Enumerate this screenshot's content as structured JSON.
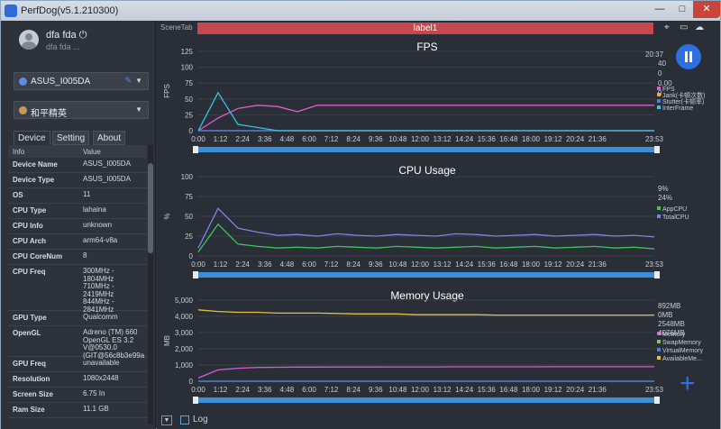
{
  "window": {
    "title": "PerfDog(v5.1.210300)",
    "min": "—",
    "max": "□",
    "close": "✕"
  },
  "user": {
    "name": "dfa fda ⏻",
    "sub": "dfa fda ..."
  },
  "device_select": {
    "value": "ASUS_I005DA",
    "icon": "android-icon"
  },
  "app_select": {
    "value": "和平精英",
    "icon": "app-icon"
  },
  "tabs": [
    "Device",
    "Setting",
    "About"
  ],
  "table": {
    "headers": [
      "Info",
      "Value"
    ],
    "rows": [
      {
        "k": "Device Name",
        "v": "ASUS_I005DA"
      },
      {
        "k": "Device Type",
        "v": "ASUS_I005DA"
      },
      {
        "k": "OS",
        "v": "11"
      },
      {
        "k": "CPU Type",
        "v": "lahaina"
      },
      {
        "k": "CPU Info",
        "v": "unknown"
      },
      {
        "k": "CPU Arch",
        "v": "arm64-v8a"
      },
      {
        "k": "CPU CoreNum",
        "v": "8"
      },
      {
        "k": "CPU Freq",
        "v": "300MHz -\n1804MHz\n710MHz -\n2419MHz\n844MHz -\n2841MHz"
      },
      {
        "k": "GPU Type",
        "v": "Qualcomm"
      },
      {
        "k": "OpenGL",
        "v": "Adreno (TM) 660\nOpenGL ES 3.2\nV@0530.0\n(GIT@56c8b3e99a"
      },
      {
        "k": "GPU Freq",
        "v": "unavailable"
      },
      {
        "k": "Resolution",
        "v": "1080x2448"
      },
      {
        "k": "Screen Size",
        "v": "6.75 In"
      },
      {
        "k": "Ram Size",
        "v": "11.1 GB"
      }
    ]
  },
  "scene": {
    "tab": "SceneTab",
    "label": "label1"
  },
  "clock": "20:37",
  "xticks": [
    "0:00",
    "1:12",
    "2:24",
    "3:36",
    "4:48",
    "6:00",
    "7:12",
    "8:24",
    "9:36",
    "10:48",
    "12:00",
    "13:12",
    "14:24",
    "15:36",
    "16:48",
    "18:00",
    "19:12",
    "20:24",
    "21:36"
  ],
  "xend": "23:53",
  "chart_data": [
    {
      "type": "line",
      "title": "FPS",
      "ylabel": "FPS",
      "yticks": [
        "125",
        "100",
        "75",
        "50",
        "25",
        "0"
      ],
      "ylim": [
        0,
        125
      ],
      "readouts": [
        {
          "value": "40",
          "color": "#e05ad0"
        },
        {
          "value": "0",
          "color": "#f0a030"
        },
        {
          "value": "0.00",
          "color": "#4a7de8"
        },
        {
          "value": "0",
          "color": "#3ac0e0"
        }
      ],
      "series": [
        {
          "name": "FPS",
          "color": "#e05ad0",
          "values": [
            0,
            20,
            35,
            40,
            38,
            30,
            40,
            40,
            40,
            40,
            40,
            40,
            40,
            40,
            40,
            40,
            40,
            40,
            40,
            40,
            40,
            40,
            40,
            40
          ]
        },
        {
          "name": "Jank(卡顿次数)",
          "color": "#f0a030",
          "values": [
            0,
            0,
            0,
            0,
            0,
            0,
            0,
            0,
            0,
            0,
            0,
            0,
            0,
            0,
            0,
            0,
            0,
            0,
            0,
            0,
            0,
            0,
            0,
            0
          ]
        },
        {
          "name": "Stutter(卡顿率)",
          "color": "#4a7de8",
          "values": [
            0,
            0,
            0,
            0,
            0,
            0,
            0,
            0,
            0,
            0,
            0,
            0,
            0,
            0,
            0,
            0,
            0,
            0,
            0,
            0,
            0,
            0,
            0,
            0
          ]
        },
        {
          "name": "InterFrame",
          "color": "#3ac0e0",
          "values": [
            0,
            60,
            10,
            5,
            0,
            0,
            0,
            0,
            0,
            0,
            0,
            0,
            0,
            0,
            0,
            0,
            0,
            0,
            0,
            0,
            0,
            0,
            0,
            0
          ]
        }
      ]
    },
    {
      "type": "line",
      "title": "CPU Usage",
      "ylabel": "%",
      "yticks": [
        "100",
        "75",
        "50",
        "25",
        "0"
      ],
      "ylim": [
        0,
        100
      ],
      "readouts": [
        {
          "value": "9%",
          "color": "#3fc45a"
        },
        {
          "value": "24%",
          "color": "#7b86e8"
        }
      ],
      "series": [
        {
          "name": "AppCPU",
          "color": "#3fc45a",
          "values": [
            5,
            40,
            15,
            12,
            10,
            11,
            10,
            12,
            11,
            10,
            12,
            11,
            10,
            11,
            12,
            10,
            11,
            12,
            10,
            11,
            12,
            10,
            11,
            9
          ]
        },
        {
          "name": "TotalCPU",
          "color": "#7b86e8",
          "values": [
            10,
            60,
            35,
            30,
            26,
            27,
            25,
            28,
            26,
            25,
            27,
            26,
            25,
            28,
            27,
            25,
            26,
            27,
            25,
            26,
            27,
            25,
            26,
            24
          ]
        }
      ]
    },
    {
      "type": "line",
      "title": "Memory Usage",
      "ylabel": "MB",
      "yticks": [
        "5,000",
        "4,000",
        "3,000",
        "2,000",
        "1,000",
        "0"
      ],
      "ylim": [
        0,
        5000
      ],
      "readouts": [
        {
          "value": "892MB",
          "color": "#d65ad0"
        },
        {
          "value": "0MB",
          "color": "#e6b830"
        },
        {
          "value": "2548MB",
          "color": "#4a7de8"
        },
        {
          "value": "4076MB",
          "color": "#e8c040"
        }
      ],
      "series": [
        {
          "name": "Memory",
          "color": "#d65ad0",
          "values": [
            200,
            700,
            800,
            850,
            860,
            870,
            870,
            880,
            880,
            880,
            885,
            885,
            885,
            890,
            890,
            890,
            890,
            890,
            892,
            892,
            892,
            892,
            892,
            892
          ]
        },
        {
          "name": "SwapMemory",
          "color": "#8bc34a",
          "values": [
            0,
            0,
            0,
            0,
            0,
            0,
            0,
            0,
            0,
            0,
            0,
            0,
            0,
            0,
            0,
            0,
            0,
            0,
            0,
            0,
            0,
            0,
            0,
            0
          ]
        },
        {
          "name": "VirtualMemory",
          "color": "#4a7de8",
          "values": [
            0,
            0,
            0,
            0,
            0,
            0,
            0,
            0,
            0,
            0,
            0,
            0,
            0,
            0,
            0,
            0,
            0,
            0,
            0,
            0,
            0,
            0,
            0,
            0
          ]
        },
        {
          "name": "AvailableMe...",
          "color": "#e8c040",
          "values": [
            4400,
            4300,
            4250,
            4250,
            4200,
            4200,
            4200,
            4180,
            4150,
            4150,
            4150,
            4100,
            4100,
            4100,
            4100,
            4080,
            4080,
            4080,
            4080,
            4076,
            4076,
            4076,
            4076,
            4076
          ]
        }
      ]
    }
  ],
  "bottom": {
    "log": "Log",
    "dropdown": "▼"
  }
}
